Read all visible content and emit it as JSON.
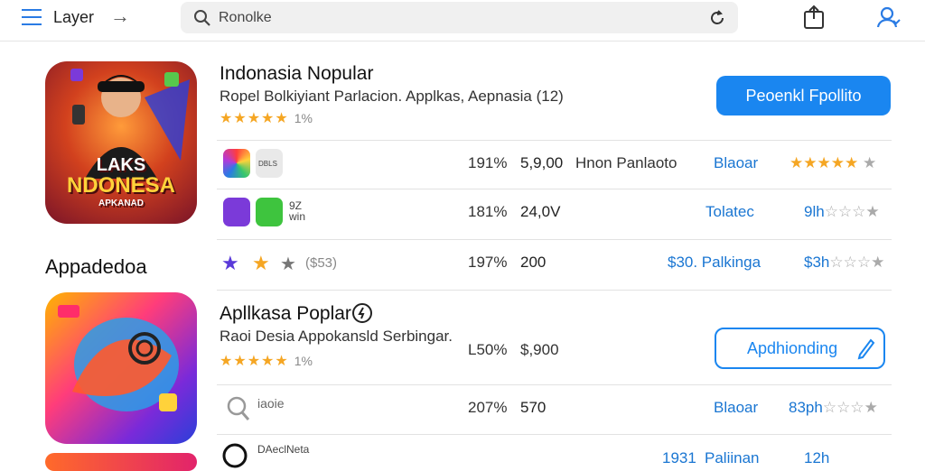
{
  "header": {
    "title": "Layer",
    "search_value": "Ronolke",
    "icons": [
      "menu-icon",
      "arrow-right-icon",
      "search-icon",
      "refresh-icon",
      "share-icon",
      "user-icon"
    ]
  },
  "app1": {
    "icon_text_top": "LAKS",
    "icon_text_main": "NDONESA",
    "icon_text_sub": "APKANAD",
    "name": "Indonasia Nopular",
    "subtitle": "Ropel Bolkiyiant Parlacion. Applkas, Aepnasia (12)",
    "stars": "★★★★★",
    "rating_count": "1%",
    "button": "Peoenkl Fpollito"
  },
  "section_label": "Appadedoa",
  "rows": [
    {
      "mini_label": "DBLS",
      "pct": "191%",
      "value": "5,9,00",
      "desc": "Hnon Panlaoto",
      "link": "Blaoar",
      "rating_text": "",
      "stars": "★★★★★",
      "grey_star": "★"
    },
    {
      "mini_label": "9Z\nwin",
      "pct": "181%",
      "value": "24,0V",
      "desc": "",
      "link": "Tolatec",
      "rating_text": "9lh",
      "stars": "☆☆☆",
      "grey_star": "★"
    },
    {
      "mini_label": "($53)",
      "pct": "197%",
      "value": "200",
      "desc": "",
      "link": "$30. Palkinga",
      "rating_text": "$3h",
      "stars": "☆☆☆",
      "grey_star": "★"
    }
  ],
  "app2": {
    "name": "Apllkasa Poplar",
    "subtitle": "Raoi Desia Appokansld Serbingar.",
    "pct": "L50%",
    "value": "$,900",
    "stars": "★★★★★",
    "rating_count": "1%",
    "button": "Apdhionding"
  },
  "row4": {
    "mini_label": "iaoie",
    "pct": "207%",
    "value": "570",
    "link": "Blaoar",
    "rating_text": "83ph",
    "stars": "☆☆☆",
    "grey_star": "★"
  },
  "row5": {
    "mini_label": "DAeclNeta",
    "pct": "1931",
    "link": "Paliinan",
    "rating_text": "12h"
  }
}
